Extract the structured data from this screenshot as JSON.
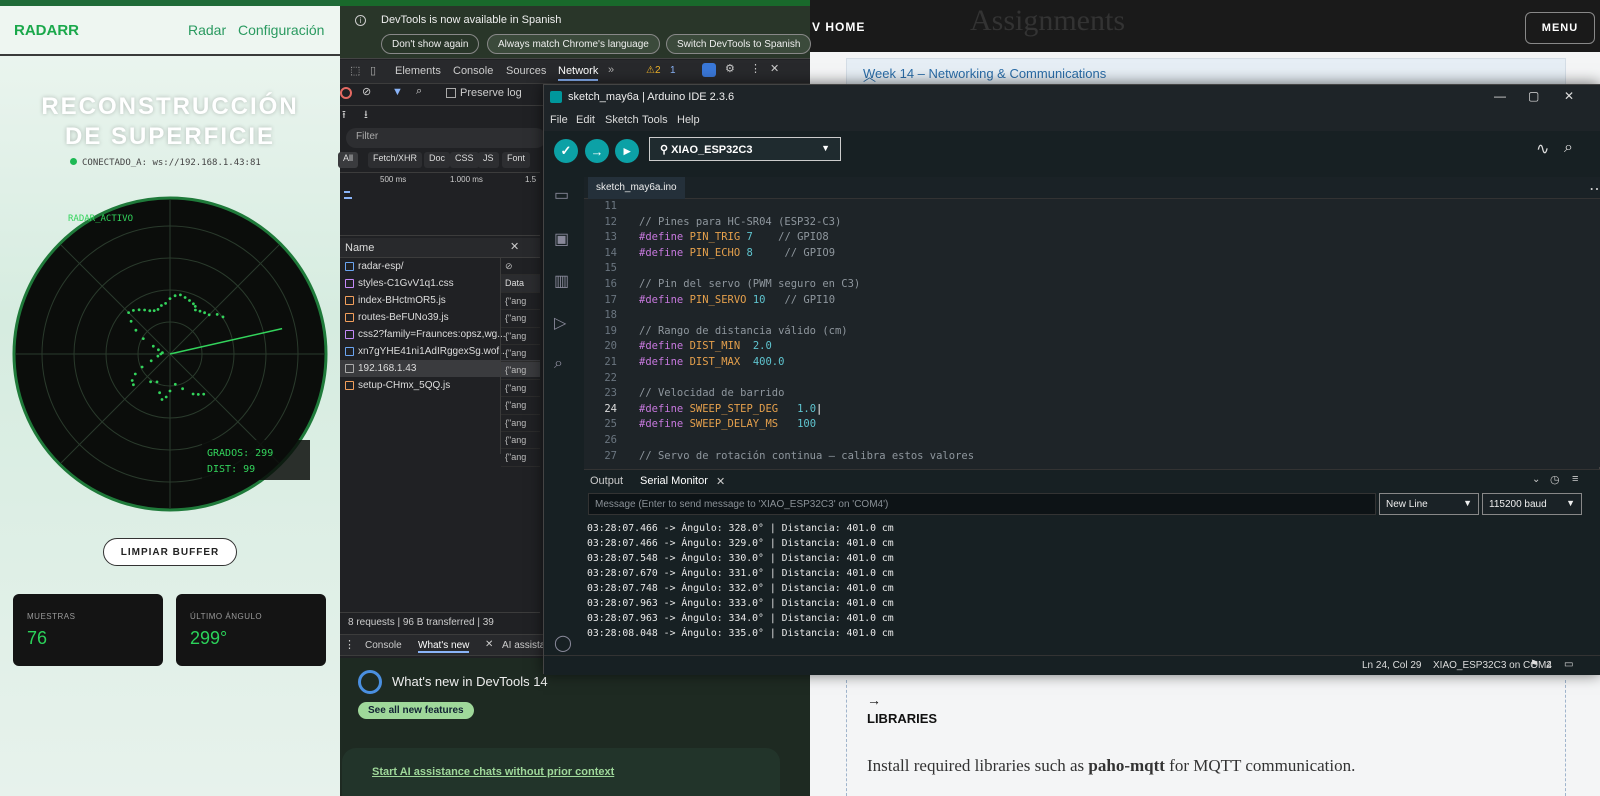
{
  "webpage": {
    "site": ":V HOME",
    "bigtitle": "Assignments",
    "menu": "MENU",
    "week": "Week 14 – Networking & Communications",
    "arrow": "→",
    "libraries": "LIBRARIES",
    "para_pre": "Install required libraries such as ",
    "para_bold": "paho-mqtt",
    "para_post": " for MQTT communication."
  },
  "radar": {
    "logo": "RADARR",
    "nav_radar": "Radar",
    "nav_config": "Configuración",
    "title_l1": "RECONSTRUCCIÓN",
    "title_l2": "DE SUPERFICIE",
    "status": "CONECTADO_A: ws://192.168.1.43:81",
    "overlay_label": "RADAR_ACTIVO",
    "grados": "GRADOS: 299",
    "dist": "DIST: 99",
    "clear_btn": "LIMPIAR BUFFER",
    "card1_label": "MUESTRAS",
    "card1_value": "76",
    "card2_label": "ÚLTIMO ÁNGULO",
    "card2_value": "299°"
  },
  "devtools": {
    "banner": "DevTools is now available in Spanish",
    "btn1": "Don't show again",
    "btn2": "Always match Chrome's language",
    "btn3": "Switch DevTools to Spanish",
    "tabs": [
      "Elements",
      "Console",
      "Sources",
      "Network"
    ],
    "warn": "⚠2",
    "msgs": "1",
    "preserve": "Preserve log",
    "filter": "Filter",
    "types": [
      "All",
      "Fetch/XHR",
      "Doc",
      "CSS",
      "JS",
      "Font"
    ],
    "time1": "500 ms",
    "time2": "1.000 ms",
    "time3": "1.5",
    "name_hdr": "Name",
    "data_hdr": "Data",
    "files": [
      "radar-esp/",
      "styles-C1GvV1q1.css",
      "index-BHctmOR5.js",
      "routes-BeFUNo39.js",
      "css2?family=Fraunces:opsz,wg...",
      "xn7gYHE41ni1AdIRggexSg.wof...",
      "192.168.1.43",
      "setup-CHmx_5QQ.js"
    ],
    "data_rows": [
      "{\"ang",
      "{\"ang",
      "{\"ang",
      "{\"ang",
      "{\"ang",
      "{\"ang",
      "{\"ang",
      "{\"ang",
      "{\"ang",
      "{\"ang"
    ],
    "requests": "8 requests",
    "transferred": "96 B transferred",
    "extra": "39",
    "drawer_tabs": [
      "Console",
      "What's new",
      "AI assista"
    ],
    "whatsnew_title": "What's new in DevTools 14",
    "see_all": "See all new features",
    "ai_link": "Start AI assistance chats without prior context"
  },
  "ide": {
    "title": "sketch_may6a | Arduino IDE 2.3.6",
    "menu": [
      "File",
      "Edit",
      "Sketch",
      "Tools",
      "Help"
    ],
    "board": "XIAO_ESP32C3",
    "file_tab": "sketch_may6a.ino",
    "output_tab": "Output",
    "serial_tab": "Serial Monitor",
    "msg_placeholder": "Message (Enter to send message to 'XIAO_ESP32C3' on 'COM4')",
    "newline": "New Line",
    "baud": "115200 baud",
    "status_pos": "Ln 24, Col 29",
    "status_board": "XIAO_ESP32C3 on COM4",
    "status_notif": "2",
    "serial_lines": [
      "03:28:07.466 -> Ángulo: 328.0° | Distancia: 401.0 cm",
      "03:28:07.466 -> Ángulo: 329.0° | Distancia: 401.0 cm",
      "03:28:07.548 -> Ángulo: 330.0° | Distancia: 401.0 cm",
      "03:28:07.670 -> Ángulo: 331.0° | Distancia: 401.0 cm",
      "03:28:07.748 -> Ángulo: 332.0° | Distancia: 401.0 cm",
      "03:28:07.963 -> Ángulo: 333.0° | Distancia: 401.0 cm",
      "03:28:07.963 -> Ángulo: 334.0° | Distancia: 401.0 cm",
      "03:28:08.048 -> Ángulo: 335.0° | Distancia: 401.0 cm"
    ]
  },
  "radar_points": [
    {
      "deg": 60,
      "r": 0.33
    },
    {
      "deg": 62,
      "r": 0.35
    },
    {
      "deg": 65,
      "r": 0.36
    },
    {
      "deg": 70,
      "r": 0.37
    },
    {
      "deg": 75,
      "r": 0.38
    },
    {
      "deg": 80,
      "r": 0.39
    },
    {
      "deg": 85,
      "r": 0.38
    },
    {
      "deg": 90,
      "r": 0.36
    },
    {
      "deg": 95,
      "r": 0.33
    },
    {
      "deg": 100,
      "r": 0.32
    },
    {
      "deg": 105,
      "r": 0.3
    },
    {
      "deg": 110,
      "r": 0.3
    },
    {
      "deg": 115,
      "r": 0.31
    },
    {
      "deg": 120,
      "r": 0.33
    },
    {
      "deg": 125,
      "r": 0.35
    },
    {
      "deg": 130,
      "r": 0.37
    },
    {
      "deg": 135,
      "r": 0.38
    },
    {
      "deg": 140,
      "r": 0.33
    },
    {
      "deg": 145,
      "r": 0.27
    },
    {
      "deg": 150,
      "r": 0.2
    },
    {
      "deg": 155,
      "r": 0.12
    },
    {
      "deg": 160,
      "r": 0.08
    },
    {
      "deg": 170,
      "r": 0.05
    },
    {
      "deg": 180,
      "r": 0.06
    },
    {
      "deg": 190,
      "r": 0.08
    },
    {
      "deg": 200,
      "r": 0.13
    },
    {
      "deg": 205,
      "r": 0.2
    },
    {
      "deg": 210,
      "r": 0.26
    },
    {
      "deg": 215,
      "r": 0.3
    },
    {
      "deg": 220,
      "r": 0.31
    },
    {
      "deg": 235,
      "r": 0.22
    },
    {
      "deg": 245,
      "r": 0.2
    },
    {
      "deg": 255,
      "r": 0.26
    },
    {
      "deg": 260,
      "r": 0.3
    },
    {
      "deg": 265,
      "r": 0.28
    },
    {
      "deg": 270,
      "r": 0.24
    },
    {
      "deg": 280,
      "r": 0.2
    },
    {
      "deg": 290,
      "r": 0.24
    },
    {
      "deg": 300,
      "r": 0.3
    },
    {
      "deg": 305,
      "r": 0.32
    },
    {
      "deg": 310,
      "r": 0.34
    },
    {
      "deg": 45,
      "r": 0.36
    },
    {
      "deg": 50,
      "r": 0.35
    },
    {
      "deg": 55,
      "r": 0.34
    },
    {
      "deg": 40,
      "r": 0.4
    },
    {
      "deg": 35,
      "r": 0.42
    }
  ],
  "sweep_angle_deg": 299,
  "colors": {
    "accent": "#1aa84b",
    "radar_green": "#33d45c",
    "ide_teal": "#0ca1a6"
  }
}
